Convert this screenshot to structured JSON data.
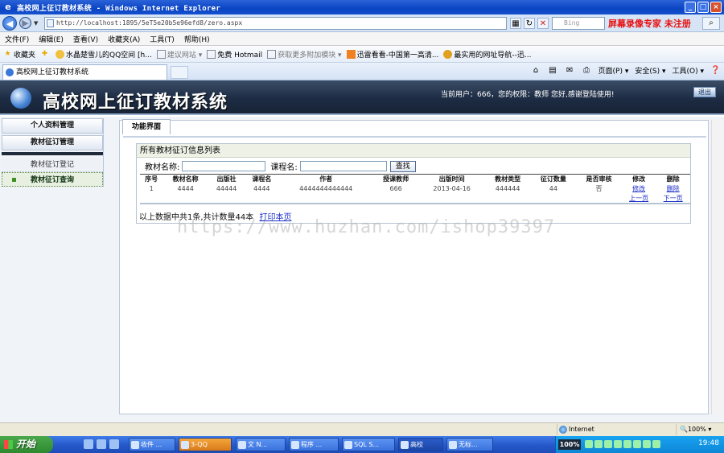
{
  "window": {
    "title": "高校网上征订教材系统 - Windows Internet Explorer",
    "url": "http://localhost:1895/5eT5e20b5e96efd8/zero.aspx",
    "search_placeholder": "Bing",
    "recorder_text": "屏幕录像专家 未注册"
  },
  "menu": [
    "文件(F)",
    "编辑(E)",
    "查看(V)",
    "收藏夹(A)",
    "工具(T)",
    "帮助(H)"
  ],
  "favorites": {
    "label": "收藏夹",
    "items": [
      {
        "label": "水晶楚雪儿的QQ空间 [h...",
        "dim": false
      },
      {
        "label": "建议网站 ▾",
        "dim": true
      },
      {
        "label": "免费 Hotmail",
        "dim": false
      },
      {
        "label": "获取更多附加模块 ▾",
        "dim": true
      },
      {
        "label": "迅雷看看-中国第一高清...",
        "dim": false
      },
      {
        "label": "最实用的网址导航--迅...",
        "dim": false
      }
    ]
  },
  "browser_tab": {
    "label": "高校网上征订教材系统"
  },
  "toolbar": {
    "page": "页面(P) ▾",
    "safety": "安全(S) ▾",
    "tools": "工具(O) ▾"
  },
  "app": {
    "title": "高校网上征订教材系统",
    "user_info": "当前用户：666，您的权限：教师 您好,感谢登陆使用!",
    "exit_label": "退出"
  },
  "sidebar": {
    "items": [
      {
        "label": "个人资料管理",
        "type": "head"
      },
      {
        "label": "教材征订管理",
        "type": "head"
      },
      {
        "label": "教材征订登记",
        "type": "sub"
      },
      {
        "label": "教材征订查询",
        "type": "active"
      }
    ]
  },
  "content": {
    "tab_label": "功能界面",
    "panel_title": "所有教材征订信息列表",
    "search": {
      "book_label": "教材名称:",
      "course_label": "课程名:",
      "button": "查找"
    },
    "table": {
      "headers": [
        "序号",
        "教材名称",
        "出版社",
        "课程名",
        "作者",
        "授课教师",
        "出版时间",
        "教材类型",
        "征订数量",
        "是否审核",
        "修改",
        "删除"
      ],
      "rows": [
        [
          "1",
          "4444",
          "44444",
          "4444",
          "4444444444444",
          "666",
          "2013-04-16",
          "444444",
          "44",
          "否",
          "修改",
          "删除"
        ]
      ],
      "pager": {
        "prev": "上一页",
        "next": "下一页"
      }
    },
    "summary": "以上数据中共1条,共计数量44本",
    "print_link": "打印本页"
  },
  "watermark": "https://www.huzhan.com/ishop39397",
  "statusbar": {
    "zone": "Internet",
    "zoom": "🔍100% ▾"
  },
  "taskbar": {
    "start": "开始",
    "tasks": [
      "收件 ...",
      "3-QQ",
      "文 N...",
      "程序 ...",
      "SQL S...",
      "高校",
      "无标..."
    ],
    "tray_pct": "100%",
    "clock": "19:48"
  }
}
